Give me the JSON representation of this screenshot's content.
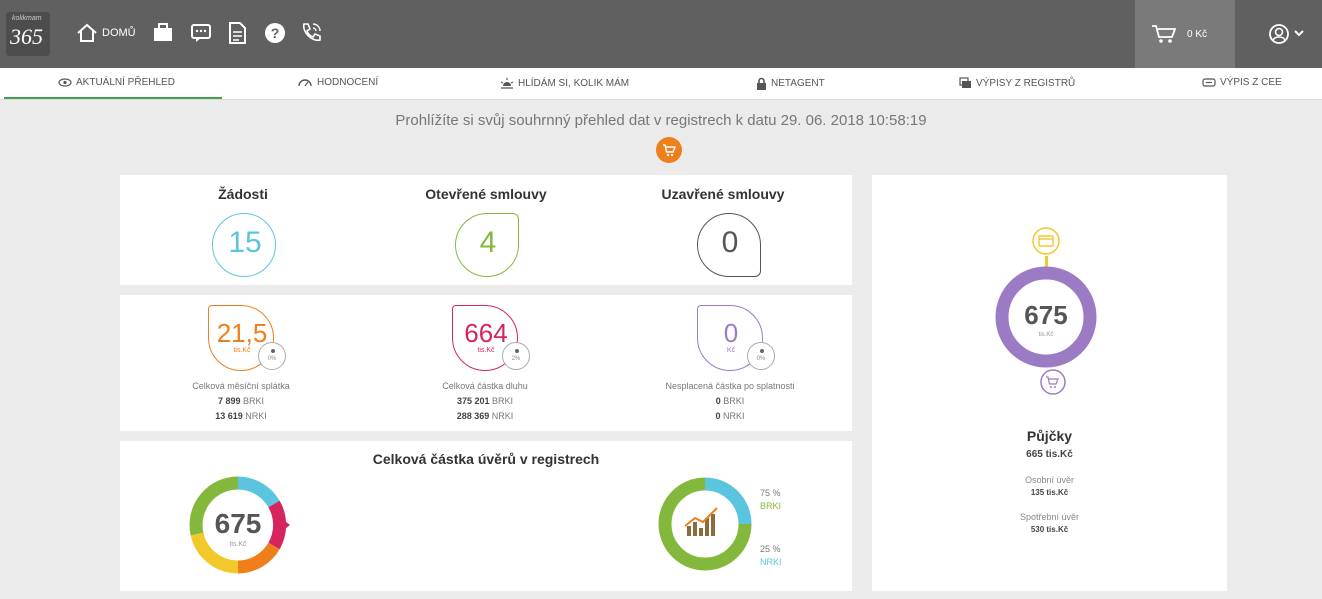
{
  "topbar": {
    "logo_small": "kolikmam",
    "logo_num": "365",
    "home_label": "DOMŮ",
    "icons": [
      "briefcase-icon",
      "chat-icon",
      "document-icon",
      "help-icon",
      "phone-icon"
    ],
    "cart_value": "0 Kč"
  },
  "tabs": [
    {
      "label": "AKTUÁLNÍ PŘEHLED",
      "icon": "eye-icon",
      "active": true
    },
    {
      "label": "HODNOCENÍ",
      "icon": "gauge-icon"
    },
    {
      "label": "HLÍDÁM SI, KOLIK MÁM",
      "icon": "sun-icon"
    },
    {
      "label": "NETAGENT",
      "icon": "lock-icon"
    },
    {
      "label": "VÝPISY Z REGISTRŮ",
      "icon": "registry-icon"
    },
    {
      "label": "VÝPIS Z CEE",
      "icon": "cee-icon"
    }
  ],
  "subtitle": "Prohlížíte si svůj souhrnný přehled dat v registrech k datu 29. 06. 2018 10:58:19",
  "counts": [
    {
      "title": "Žádosti",
      "value": "15",
      "color": "#5bc4df"
    },
    {
      "title": "Otevřené smlouvy",
      "value": "4",
      "color": "#84b83c"
    },
    {
      "title": "Uzavřené smlouvy",
      "value": "0",
      "color": "#555555"
    }
  ],
  "metrics": [
    {
      "value": "21,5",
      "unit": "tis.Kč",
      "pct": "0%",
      "label": "Celková měsíční splátka",
      "brki_val": "7 899",
      "brki": "BRKI",
      "nrki_val": "13 619",
      "nrki": "NRKI",
      "color": "#ef7f1a"
    },
    {
      "value": "664",
      "unit": "tis.Kč",
      "pct": "2%",
      "label": "Celková částka dluhu",
      "brki_val": "375 201",
      "brki": "BRKI",
      "nrki_val": "288 369",
      "nrki": "NRKI",
      "color": "#d6245f"
    },
    {
      "value": "0",
      "unit": "Kč",
      "pct": "0%",
      "label": "Nesplacená částka po splatnosti",
      "brki_val": "0",
      "brki": "BRKI",
      "nrki_val": "0",
      "nrki": "NRKI",
      "color": "#9b7cc4"
    }
  ],
  "loans": {
    "title": "Celková částka úvěrů v registrech",
    "total": "675",
    "unit": "tis.Kč",
    "brki_pct": "75 %",
    "brki": "BRKI",
    "nrki_pct": "25 %",
    "nrki": "NRKI",
    "colors": {
      "brki": "#84b83c",
      "nrki": "#5bc4df"
    }
  },
  "side": {
    "total": "675",
    "unit": "tis.Kč",
    "title": "Půjčky",
    "amount": "665 tis.Kč",
    "items": [
      {
        "label": "Osobní úvěr",
        "value": "135 tis.Kč"
      },
      {
        "label": "Spotřební úvěr",
        "value": "530 tis.Kč"
      }
    ],
    "ring_color": "#9b7cc4",
    "card_color": "#f3c82a"
  }
}
